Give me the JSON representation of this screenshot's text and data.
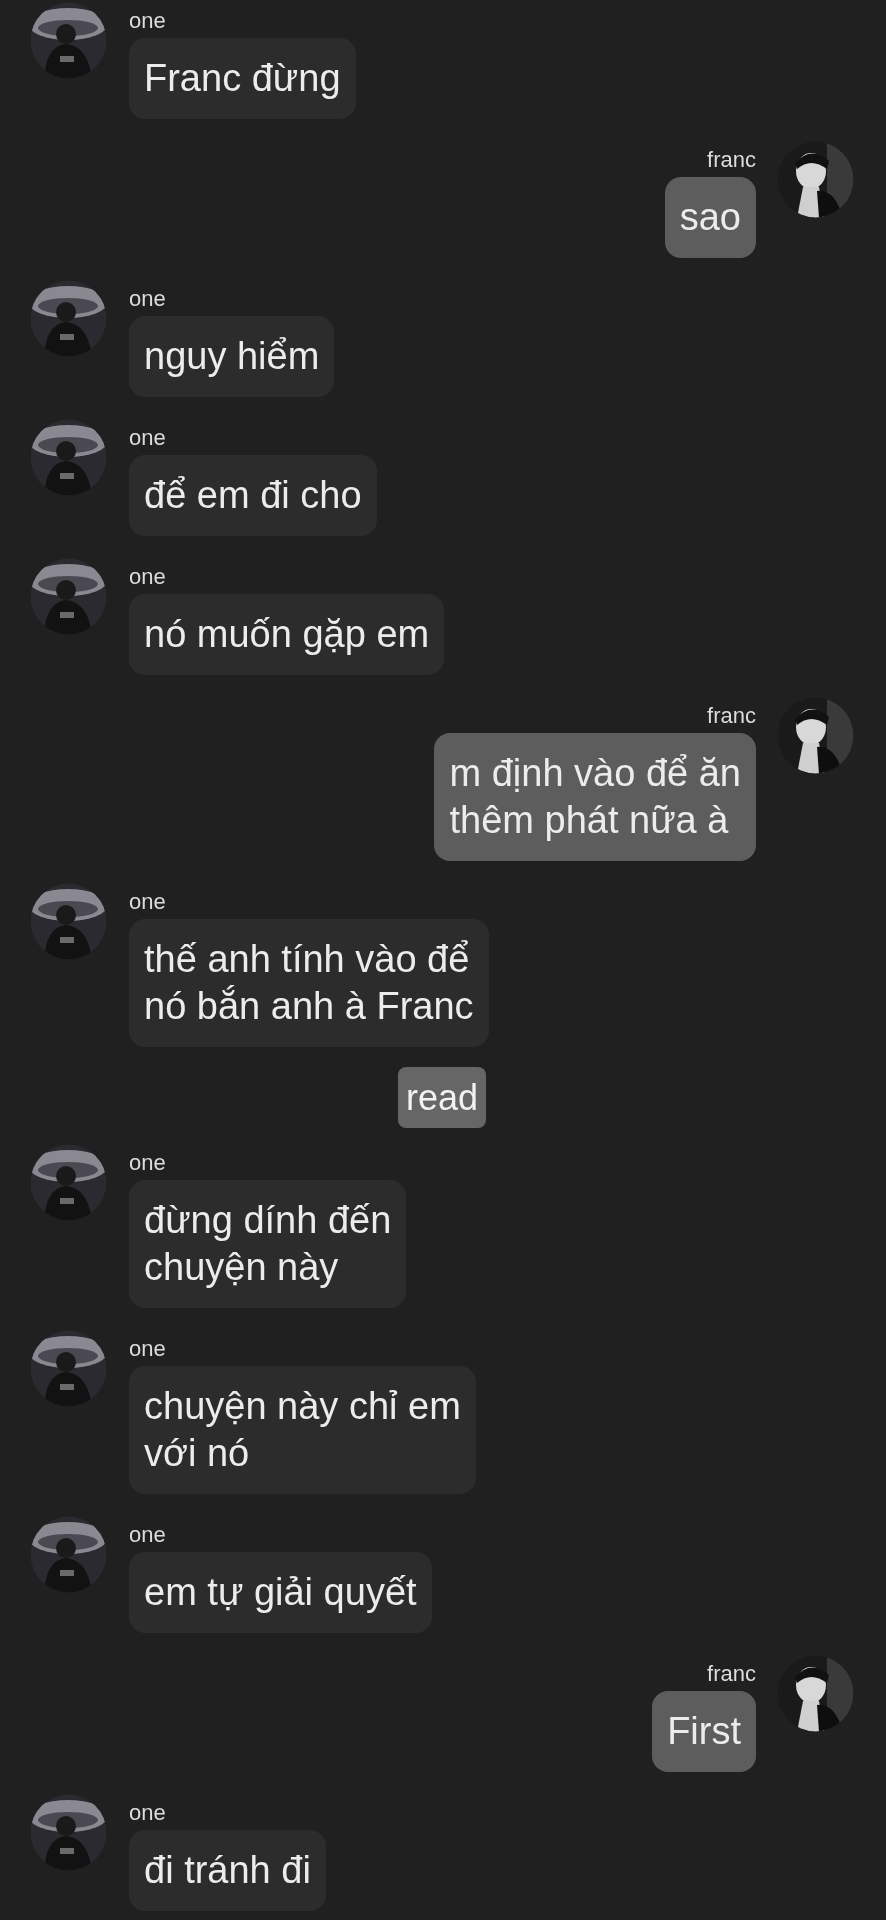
{
  "messages": [
    {
      "kind": "message",
      "outgoing": false,
      "sender": "one",
      "text": "Franc đừng"
    },
    {
      "kind": "message",
      "outgoing": true,
      "sender": "franc",
      "text": "sao"
    },
    {
      "kind": "message",
      "outgoing": false,
      "sender": "one",
      "text": "nguy hiểm"
    },
    {
      "kind": "message",
      "outgoing": false,
      "sender": "one",
      "text": "để em đi cho"
    },
    {
      "kind": "message",
      "outgoing": false,
      "sender": "one",
      "text": "nó muốn gặp em"
    },
    {
      "kind": "message",
      "outgoing": true,
      "sender": "franc",
      "text": "m định vào để ăn\nthêm phát nữa à"
    },
    {
      "kind": "message",
      "outgoing": false,
      "sender": "one",
      "text": "thế anh tính vào để\nnó bắn anh à Franc"
    },
    {
      "kind": "status",
      "text": "read"
    },
    {
      "kind": "message",
      "outgoing": false,
      "sender": "one",
      "text": "đừng dính đến\nchuyện này"
    },
    {
      "kind": "message",
      "outgoing": false,
      "sender": "one",
      "text": "chuyện này chỉ em\nvới nó"
    },
    {
      "kind": "message",
      "outgoing": false,
      "sender": "one",
      "text": "em tự giải quyết"
    },
    {
      "kind": "message",
      "outgoing": true,
      "sender": "franc",
      "text": "First"
    },
    {
      "kind": "message",
      "outgoing": false,
      "sender": "one",
      "text": "đi tránh đi"
    }
  ]
}
